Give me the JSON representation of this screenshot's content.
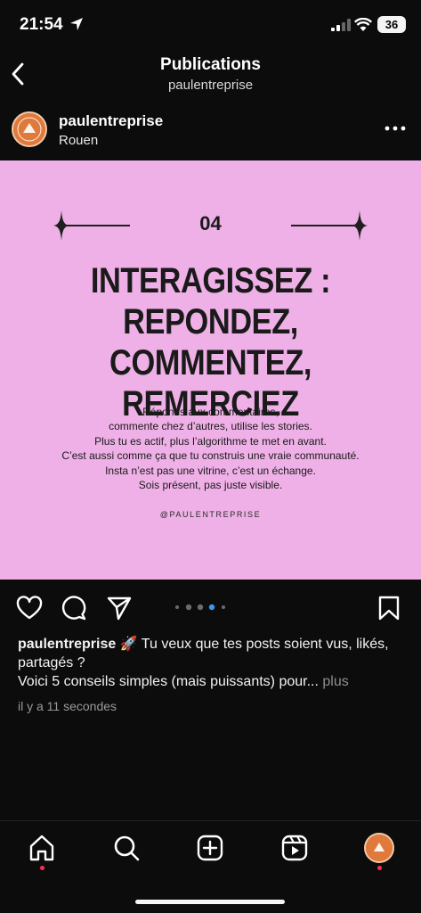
{
  "status_bar": {
    "time": "21:54",
    "battery": "36"
  },
  "header": {
    "title": "Publications",
    "subtitle": "paulentreprise"
  },
  "post": {
    "author": "paulentreprise",
    "location": "Rouen",
    "image": {
      "number": "04",
      "headline_lines": [
        "INTERAGISSEZ :",
        "REPONDEZ, COMMENTEZ,",
        "REMERCIEZ"
      ],
      "body_lines": [
        "Réponds aux commentaires,",
        "commente chez d’autres, utilise les stories.",
        "Plus tu es actif, plus l’algorithme te met en avant.",
        "C’est aussi comme ça que tu construis une vraie communauté.",
        "Insta n’est pas une vitrine, c’est un échange.",
        "Sois présent, pas juste visible."
      ],
      "handle": "@PAULENTREPRISE",
      "background_color": "#eeb0e6"
    },
    "carousel": {
      "total": 5,
      "active_index": 3
    },
    "caption": {
      "user": "paulentreprise",
      "line1": "🚀 Tu veux que tes posts soient vus, likés, partagés ?",
      "line2": "Voici 5 conseils simples (mais puissants) pour...",
      "more": "plus"
    },
    "timestamp": "il y a 11 secondes"
  },
  "icons": {
    "back": "chevron-left-icon",
    "more": "more-horizontal-icon",
    "like": "heart-icon",
    "comment": "comment-icon",
    "share": "send-icon",
    "save": "bookmark-icon",
    "nav": [
      "home-icon",
      "search-icon",
      "create-icon",
      "reels-icon",
      "profile-avatar"
    ]
  },
  "colors": {
    "accent_dot": "#ff2d55",
    "avatar": "#e07a3c"
  }
}
